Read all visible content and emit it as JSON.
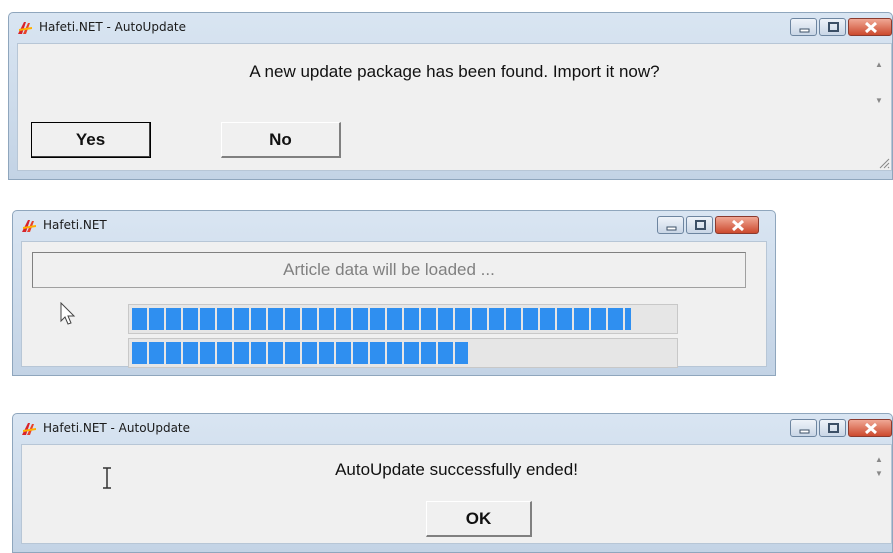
{
  "dialog1": {
    "title": "Hafeti.NET - AutoUpdate",
    "message": "A new update package has been found. Import it now?",
    "yes_label": "Yes",
    "no_label": "No"
  },
  "dialog2": {
    "title": "Hafeti.NET",
    "status_text": "Article data will be loaded ...",
    "progress_1": 0.92,
    "progress_2": 0.62
  },
  "dialog3": {
    "title": "Hafeti.NET - AutoUpdate",
    "message": "AutoUpdate successfully ended!",
    "ok_label": "OK"
  },
  "icons": [
    "app-icon",
    "minimize-icon",
    "maximize-icon",
    "close-icon",
    "scroll-up-icon",
    "scroll-down-icon",
    "resize-grip-icon",
    "mouse-pointer-icon",
    "text-cursor-icon"
  ],
  "colors": {
    "titlebar": "#d9e5f2",
    "client": "#f0f0f0",
    "progress_fill": "#2f8ff0",
    "close_button": "#cc4a2e"
  }
}
